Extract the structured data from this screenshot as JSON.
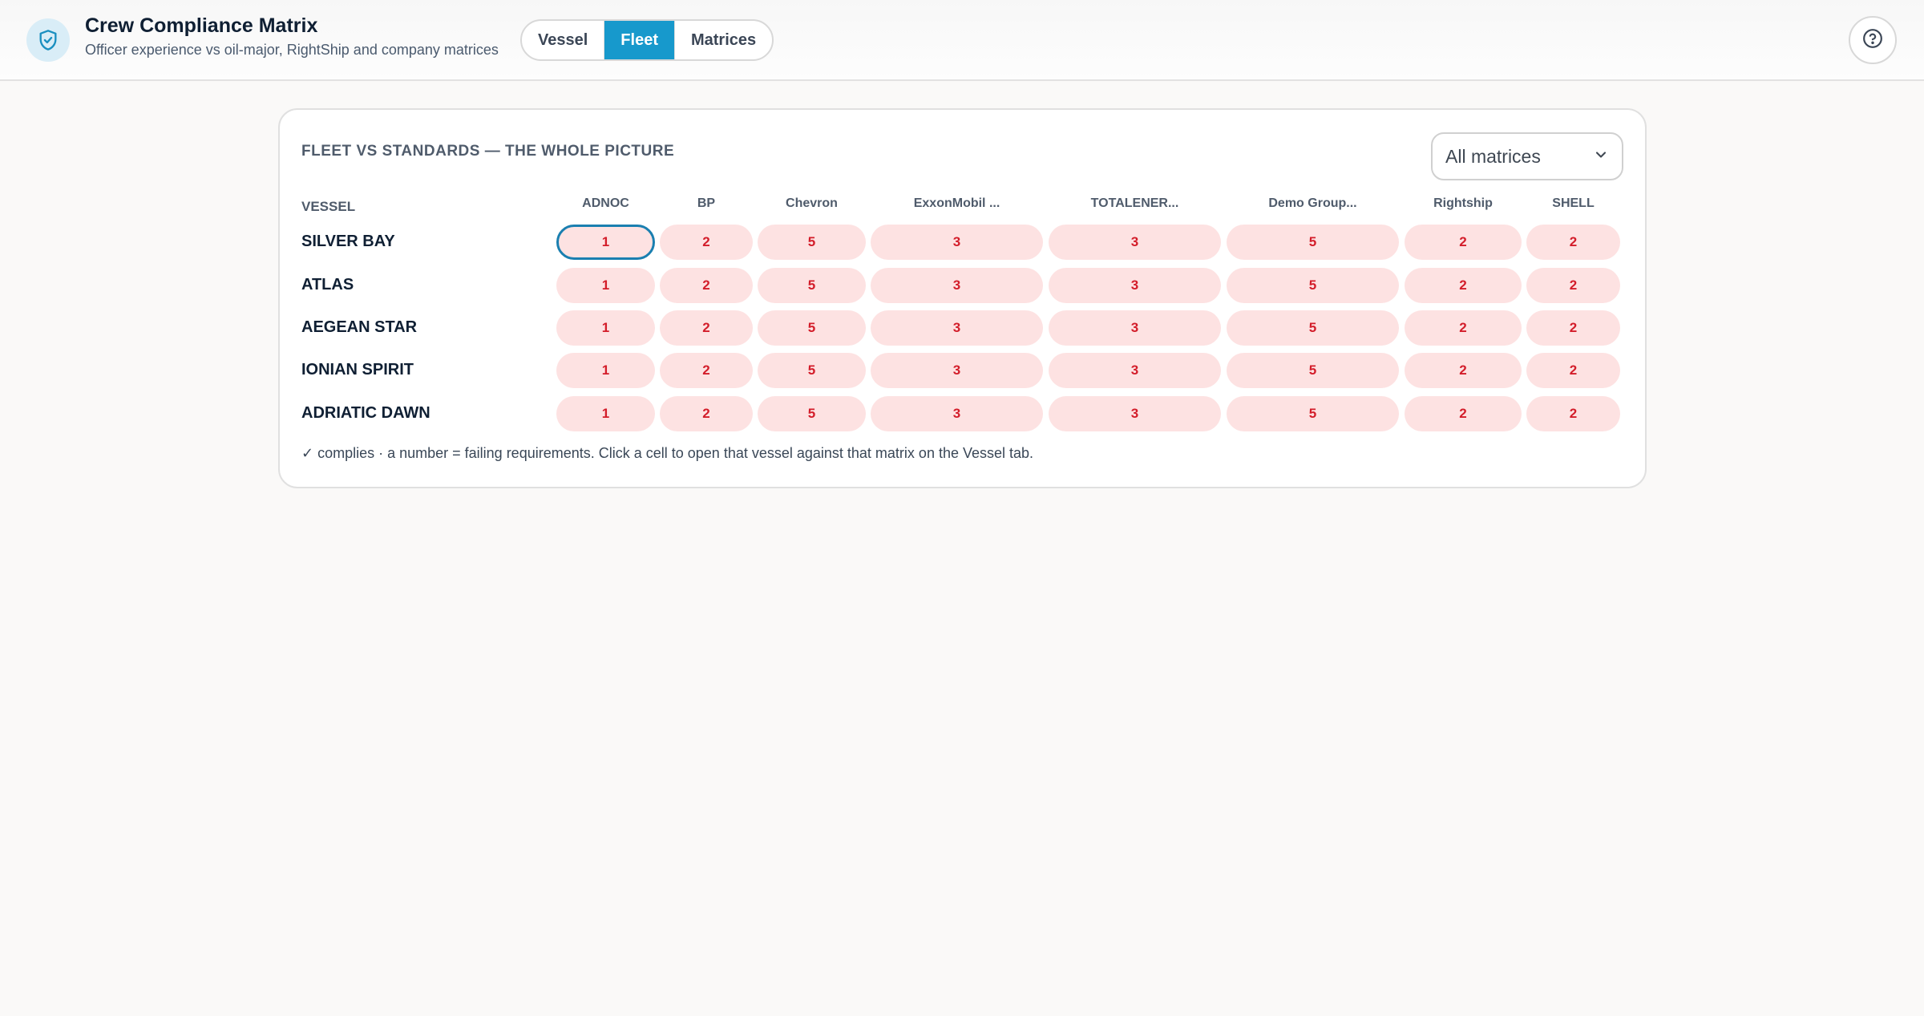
{
  "app": {
    "title": "Crew Compliance Matrix",
    "subtitle": "Officer experience vs oil-major, RightShip and company matrices"
  },
  "tabs": [
    {
      "label": "Vessel",
      "active": false
    },
    {
      "label": "Fleet",
      "active": true
    },
    {
      "label": "Matrices",
      "active": false
    }
  ],
  "card": {
    "title": "FLEET VS STANDARDS — THE WHOLE PICTURE",
    "select_value": "All matrices",
    "vessel_header": "VESSEL",
    "columns": [
      "ADNOC",
      "BP",
      "Chevron",
      "ExxonMobil ...",
      "TOTALENER...",
      "Demo Group...",
      "Rightship",
      "SHELL"
    ],
    "rows": [
      {
        "vessel": "SILVER BAY",
        "values": [
          "1",
          "2",
          "5",
          "3",
          "3",
          "5",
          "2",
          "2"
        ]
      },
      {
        "vessel": "ATLAS",
        "values": [
          "1",
          "2",
          "5",
          "3",
          "3",
          "5",
          "2",
          "2"
        ]
      },
      {
        "vessel": "AEGEAN STAR",
        "values": [
          "1",
          "2",
          "5",
          "3",
          "3",
          "5",
          "2",
          "2"
        ]
      },
      {
        "vessel": "IONIAN SPIRIT",
        "values": [
          "1",
          "2",
          "5",
          "3",
          "3",
          "5",
          "2",
          "2"
        ]
      },
      {
        "vessel": "ADRIATIC DAWN",
        "values": [
          "1",
          "2",
          "5",
          "3",
          "3",
          "5",
          "2",
          "2"
        ]
      }
    ],
    "note": "✓ complies · a number = failing requirements. Click a cell to open that vessel against that matrix on the Vessel tab."
  },
  "colors": {
    "accent": "#1799cc",
    "fail_bg": "#fde2e2",
    "fail_text": "#d31d2a"
  },
  "icons": {
    "logo": "shield-check-icon",
    "help": "help-circle-icon",
    "dropdown": "chevron-down-icon"
  }
}
